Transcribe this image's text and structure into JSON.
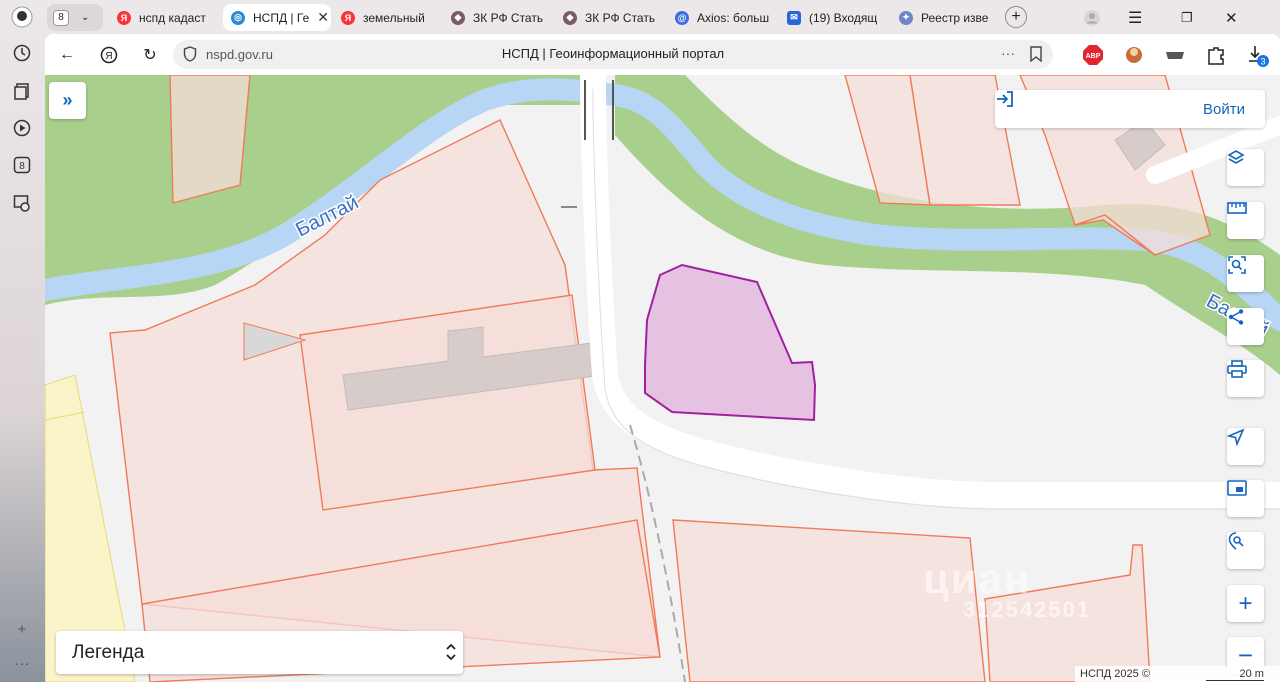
{
  "browser": {
    "tabs": [
      {
        "label": "нспд кадаст",
        "icon": "yandex-icon",
        "active": false
      },
      {
        "label": "НСПД | Ге",
        "icon": "nspd-icon",
        "active": true
      },
      {
        "label": "земельный",
        "icon": "yandex-icon",
        "active": false
      },
      {
        "label": "ЗК РФ Стать",
        "icon": "consultant-icon",
        "active": false
      },
      {
        "label": "ЗК РФ Стать",
        "icon": "consultant-icon",
        "active": false
      },
      {
        "label": "Axios: больш",
        "icon": "axios-icon",
        "active": false
      },
      {
        "label": "(19) Входящ",
        "icon": "mail-icon",
        "active": false
      },
      {
        "label": "Реестр изве",
        "icon": "emblem-icon",
        "active": false
      }
    ],
    "tab_counter": "8",
    "address": "nspd.gov.ru",
    "page_title": "НСПД | Геоинформационный портал",
    "abp_badge": "ABP",
    "downloads_count": "3"
  },
  "map": {
    "login_label": "Войти",
    "legend_label": "Легенда",
    "river_label_left": "Балтай",
    "river_label_right": "Балтай",
    "footer_copyright": "НСПД 2025 ©",
    "scale_label": "20 m",
    "watermark_text": "циан",
    "watermark_id": "312542501"
  },
  "colors": {
    "accent": "#1565c0",
    "parcel_fill": "#f6ddd8",
    "parcel_stroke": "#f07a5a",
    "selected_fill": "#e4bfe0",
    "selected_stroke": "#a020a0",
    "river": "#b7d6f5",
    "vegetation": "#a8cf8c"
  }
}
